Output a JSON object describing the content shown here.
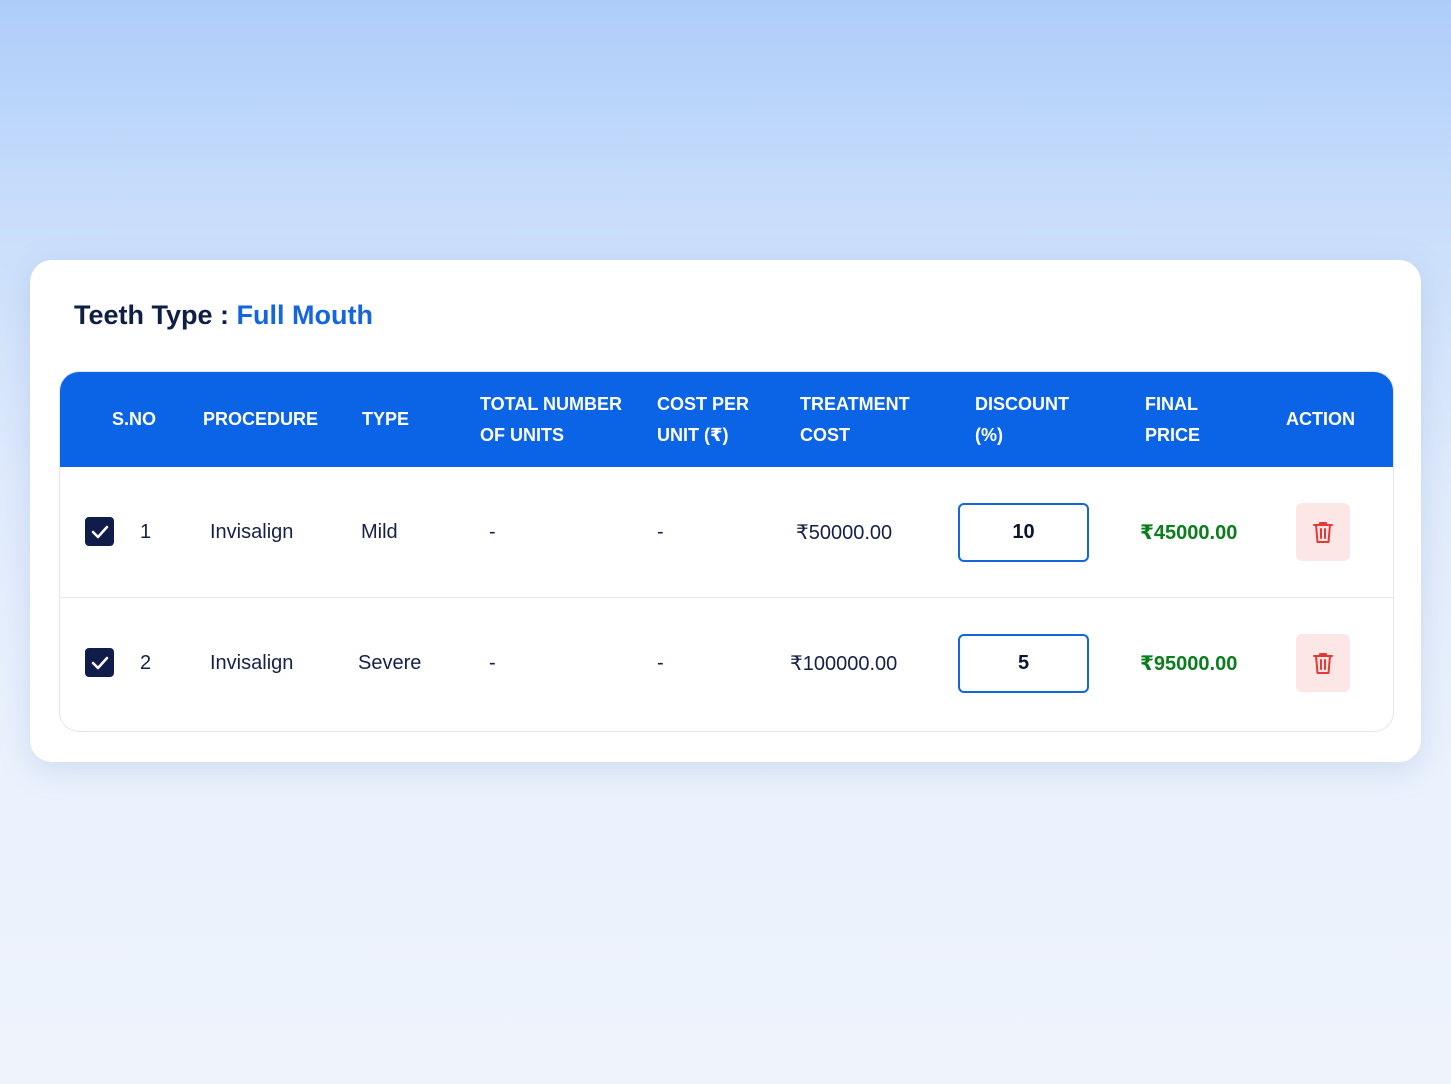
{
  "header": {
    "label": "Teeth Type :",
    "value": "Full Mouth"
  },
  "table": {
    "columns": {
      "sno": "S.NO",
      "procedure": "PROCEDURE",
      "type": "TYPE",
      "units_line1": "TOTAL NUMBER",
      "units_line2": "OF UNITS",
      "cost_line1": "COST PER",
      "cost_line2": "UNIT (₹)",
      "treatment_line1": "TREATMENT",
      "treatment_line2": "COST",
      "discount_line1": "DISCOUNT",
      "discount_line2": "(%)",
      "final_line1": "FINAL",
      "final_line2": "PRICE",
      "action": "ACTION"
    },
    "rows": [
      {
        "checked": true,
        "sno": "1",
        "procedure": "Invisalign",
        "type": "Mild",
        "units": "-",
        "cost_per_unit": "-",
        "treatment_cost": "₹50000.00",
        "discount": "10",
        "final_price": "₹45000.00"
      },
      {
        "checked": true,
        "sno": "2",
        "procedure": "Invisalign",
        "type": "Severe",
        "units": "-",
        "cost_per_unit": "-",
        "treatment_cost": "₹100000.00",
        "discount": "5",
        "final_price": "₹95000.00"
      }
    ]
  },
  "colors": {
    "accent": "#0b63e5",
    "title_value": "#1565e0",
    "final_price": "#0a7d1d",
    "delete_icon": "#e53935",
    "delete_bg": "#fde6e6",
    "checkbox": "#101d4a"
  },
  "icons": {
    "checkbox": "check-icon",
    "delete": "trash-icon"
  }
}
